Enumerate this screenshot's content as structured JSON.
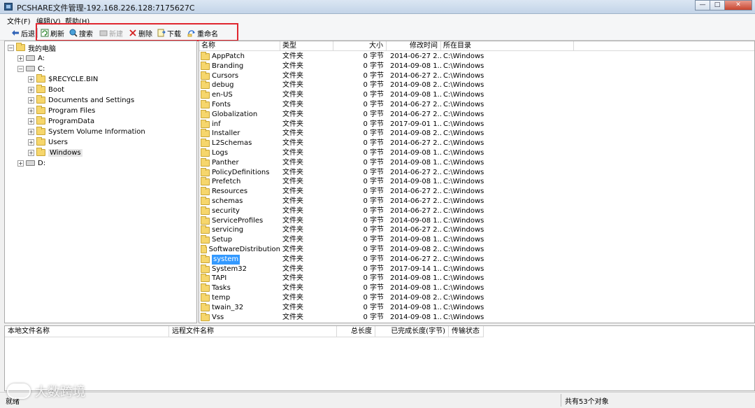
{
  "window": {
    "title": "PCSHARE文件管理-192.168.226.128:7175627C",
    "controls": [
      "—",
      "□",
      "✕"
    ]
  },
  "menu": [
    "文件(F)",
    "编辑(V)",
    "帮助(H)"
  ],
  "toolbar": {
    "back": "后退",
    "refresh": "刷新",
    "search": "搜索",
    "new": "新建",
    "delete": "删除",
    "download": "下载",
    "rename": "重命名"
  },
  "tree": {
    "root": "我的电脑",
    "drive_a": "A:",
    "drive_c": "C:",
    "folders": [
      "$RECYCLE.BIN",
      "Boot",
      "Documents and Settings",
      "Program Files",
      "ProgramData",
      "System Volume Information",
      "Users",
      "Windows"
    ],
    "selected": "Windows",
    "drive_d": "D:"
  },
  "list": {
    "columns": [
      "名称",
      "类型",
      "大小",
      "修改时间",
      "所在目录"
    ],
    "rows": [
      [
        "AppPatch",
        "文件夹",
        "0 字节",
        "2014-06-27 2...",
        "C:\\Windows"
      ],
      [
        "Branding",
        "文件夹",
        "0 字节",
        "2014-09-08 1...",
        "C:\\Windows"
      ],
      [
        "Cursors",
        "文件夹",
        "0 字节",
        "2014-06-27 2...",
        "C:\\Windows"
      ],
      [
        "debug",
        "文件夹",
        "0 字节",
        "2014-09-08 2...",
        "C:\\Windows"
      ],
      [
        "en-US",
        "文件夹",
        "0 字节",
        "2014-09-08 1...",
        "C:\\Windows"
      ],
      [
        "Fonts",
        "文件夹",
        "0 字节",
        "2014-06-27 2...",
        "C:\\Windows"
      ],
      [
        "Globalization",
        "文件夹",
        "0 字节",
        "2014-06-27 2...",
        "C:\\Windows"
      ],
      [
        "inf",
        "文件夹",
        "0 字节",
        "2017-09-01 1...",
        "C:\\Windows"
      ],
      [
        "Installer",
        "文件夹",
        "0 字节",
        "2014-09-08 2...",
        "C:\\Windows"
      ],
      [
        "L2Schemas",
        "文件夹",
        "0 字节",
        "2014-06-27 2...",
        "C:\\Windows"
      ],
      [
        "Logs",
        "文件夹",
        "0 字节",
        "2014-09-08 1...",
        "C:\\Windows"
      ],
      [
        "Panther",
        "文件夹",
        "0 字节",
        "2014-09-08 1...",
        "C:\\Windows"
      ],
      [
        "PolicyDefinitions",
        "文件夹",
        "0 字节",
        "2014-06-27 2...",
        "C:\\Windows"
      ],
      [
        "Prefetch",
        "文件夹",
        "0 字节",
        "2014-09-08 1...",
        "C:\\Windows"
      ],
      [
        "Resources",
        "文件夹",
        "0 字节",
        "2014-06-27 2...",
        "C:\\Windows"
      ],
      [
        "schemas",
        "文件夹",
        "0 字节",
        "2014-06-27 2...",
        "C:\\Windows"
      ],
      [
        "security",
        "文件夹",
        "0 字节",
        "2014-06-27 2...",
        "C:\\Windows"
      ],
      [
        "ServiceProfiles",
        "文件夹",
        "0 字节",
        "2014-09-08 1...",
        "C:\\Windows"
      ],
      [
        "servicing",
        "文件夹",
        "0 字节",
        "2014-06-27 2...",
        "C:\\Windows"
      ],
      [
        "Setup",
        "文件夹",
        "0 字节",
        "2014-09-08 1...",
        "C:\\Windows"
      ],
      [
        "SoftwareDistribution",
        "文件夹",
        "0 字节",
        "2014-09-08 2...",
        "C:\\Windows"
      ],
      [
        "system",
        "文件夹",
        "0 字节",
        "2014-06-27 2...",
        "C:\\Windows"
      ],
      [
        "System32",
        "文件夹",
        "0 字节",
        "2017-09-14 1...",
        "C:\\Windows"
      ],
      [
        "TAPI",
        "文件夹",
        "0 字节",
        "2014-09-08 1...",
        "C:\\Windows"
      ],
      [
        "Tasks",
        "文件夹",
        "0 字节",
        "2014-09-08 1...",
        "C:\\Windows"
      ],
      [
        "temp",
        "文件夹",
        "0 字节",
        "2014-09-08 2...",
        "C:\\Windows"
      ],
      [
        "twain_32",
        "文件夹",
        "0 字节",
        "2014-09-08 1...",
        "C:\\Windows"
      ],
      [
        "Vss",
        "文件夹",
        "0 字节",
        "2014-09-08 1...",
        "C:\\Windows"
      ]
    ],
    "selected_index": 21
  },
  "transfer": {
    "columns": [
      "本地文件名称",
      "远程文件名称",
      "总长度",
      "已完成长度(字节)",
      "传输状态"
    ]
  },
  "status": {
    "left": "就绪",
    "right": "共有53个对象"
  },
  "watermark": "大数跨境",
  "colors": {
    "highlight_box": "#e0262f",
    "selection": "#3399ff",
    "folder": "#f6d66c"
  }
}
